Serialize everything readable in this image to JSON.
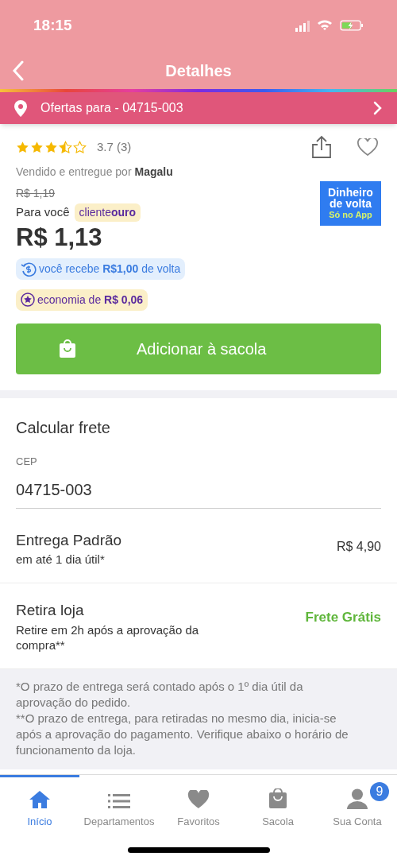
{
  "status_bar": {
    "time": "18:15"
  },
  "header": {
    "title": "Detalhes"
  },
  "location_bar": {
    "label": "Ofertas para - 04715-003"
  },
  "product": {
    "stars": 3.5,
    "rating": "3.7 (3)",
    "seller_prefix": "Vendido e entregue por",
    "seller": "Magalu",
    "old_price": "R$ 1,19",
    "for_you": "Para você",
    "club_badge": "cliente**ouro**",
    "price": "R$ 1,13",
    "cashback": "você recebe **R$1,00** de volta",
    "savings": "economia de **R$ 0,06**",
    "promo_banner": {
      "title": "Dinheiro de volta",
      "subtitle": "Só no App"
    },
    "add_button": "Adicionar à sacola"
  },
  "shipping": {
    "title": "Calcular frete",
    "cep_label": "CEP",
    "cep_value": "04715-003",
    "options": [
      {
        "name": "Entrega Padrão",
        "detail": "em até 1 dia útil*",
        "price": "R$ 4,90",
        "free": false
      },
      {
        "name": "Retira loja",
        "detail": "Retire em 2h após a aprovação da compra**",
        "price": "Frete Grátis",
        "free": true
      }
    ],
    "notes": [
      "*O prazo de entrega será contado após o 1º dia útil da aprovação do pedido.",
      "**O prazo de entrega, para retiradas no mesmo dia, inicia-se após a aprovação do pagamento. Verifique abaixo o horário de funcionamento da loja."
    ]
  },
  "tab_bar": [
    {
      "label": "Início",
      "kind": "home",
      "selected": true
    },
    {
      "label": "Departamentos",
      "kind": "list",
      "selected": false
    },
    {
      "label": "Favoritos",
      "kind": "heart",
      "selected": false
    },
    {
      "label": "Sacola",
      "kind": "bag",
      "selected": false
    },
    {
      "label": "Sua Conta",
      "kind": "user",
      "selected": false,
      "badge": "9"
    }
  ]
}
